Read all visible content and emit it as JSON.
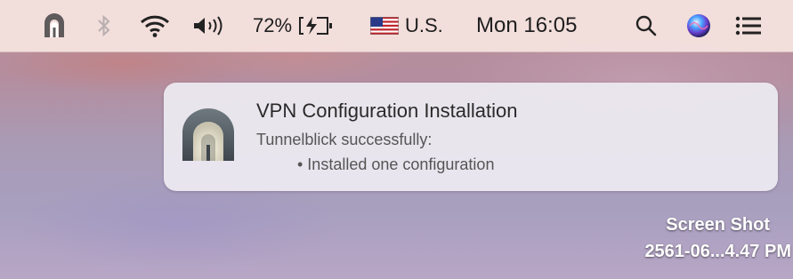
{
  "menubar": {
    "icons": [
      "tunnelblick-icon",
      "bluetooth-icon",
      "wifi-icon",
      "volume-icon",
      "battery-icon",
      "search-icon",
      "siri-icon",
      "notification-center-icon"
    ],
    "battery_percent": "72%",
    "battery_level": 0.72,
    "input_source": "U.S.",
    "clock": "Mon 16:05"
  },
  "notification": {
    "title": "VPN Configuration Installation",
    "subtitle": "Tunnelblick successfully:",
    "bullet": "• Installed one configuration",
    "icon": "tunnelblick-app-icon"
  },
  "desktop": {
    "file_label_line1": "Screen Shot",
    "file_label_line2": "2561-06...4.47 PM"
  }
}
